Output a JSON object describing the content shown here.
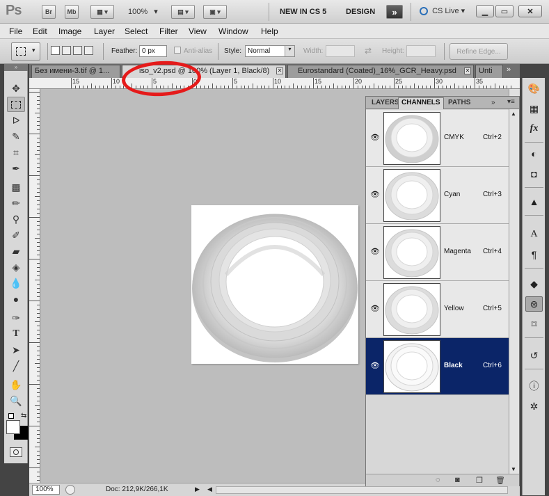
{
  "appbar": {
    "logo": "Ps",
    "br_label": "Br",
    "mb_label": "Mb",
    "zoom": "100%",
    "workspace_new": "NEW IN CS 5",
    "workspace_design": "DESIGN",
    "more": "»",
    "cslive": "CS Live"
  },
  "menu": [
    "File",
    "Edit",
    "Image",
    "Layer",
    "Select",
    "Filter",
    "View",
    "Window",
    "Help"
  ],
  "options": {
    "feather_label": "Feather:",
    "feather_value": "0 px",
    "antialias_label": "Anti-alias",
    "style_label": "Style:",
    "style_value": "Normal",
    "width_label": "Width:",
    "height_label": "Height:",
    "refine_edge": "Refine Edge..."
  },
  "tabs": [
    {
      "label": "Без имени-3.tif @ 1...",
      "active": false
    },
    {
      "label": "iso_v2.psd @ 100% (Layer 1, Black/8)",
      "active": true
    },
    {
      "label": "Eurostandard (Coated)_16%_GCR_Heavy.psd",
      "active": false
    },
    {
      "label": "Unti",
      "active": false
    }
  ],
  "ruler_top_numbers": [
    "15",
    "10",
    "5",
    "0",
    "5",
    "10",
    "15",
    "20",
    "25",
    "30",
    "35"
  ],
  "status": {
    "zoom": "100%",
    "doc": "Doc: 212,9K/266,1K"
  },
  "panel": {
    "tabs": [
      "LAYERS",
      "CHANNELS",
      "PATHS"
    ],
    "active_tab": "CHANNELS",
    "channels": [
      {
        "name": "CMYK",
        "shortcut": "Ctrl+2",
        "selected": false
      },
      {
        "name": "Cyan",
        "shortcut": "Ctrl+3",
        "selected": false
      },
      {
        "name": "Magenta",
        "shortcut": "Ctrl+4",
        "selected": false
      },
      {
        "name": "Yellow",
        "shortcut": "Ctrl+5",
        "selected": false
      },
      {
        "name": "Black",
        "shortcut": "Ctrl+6",
        "selected": true
      }
    ]
  },
  "colors": {
    "selected_row": "#0b2568",
    "annotation": "#e51a1a"
  }
}
